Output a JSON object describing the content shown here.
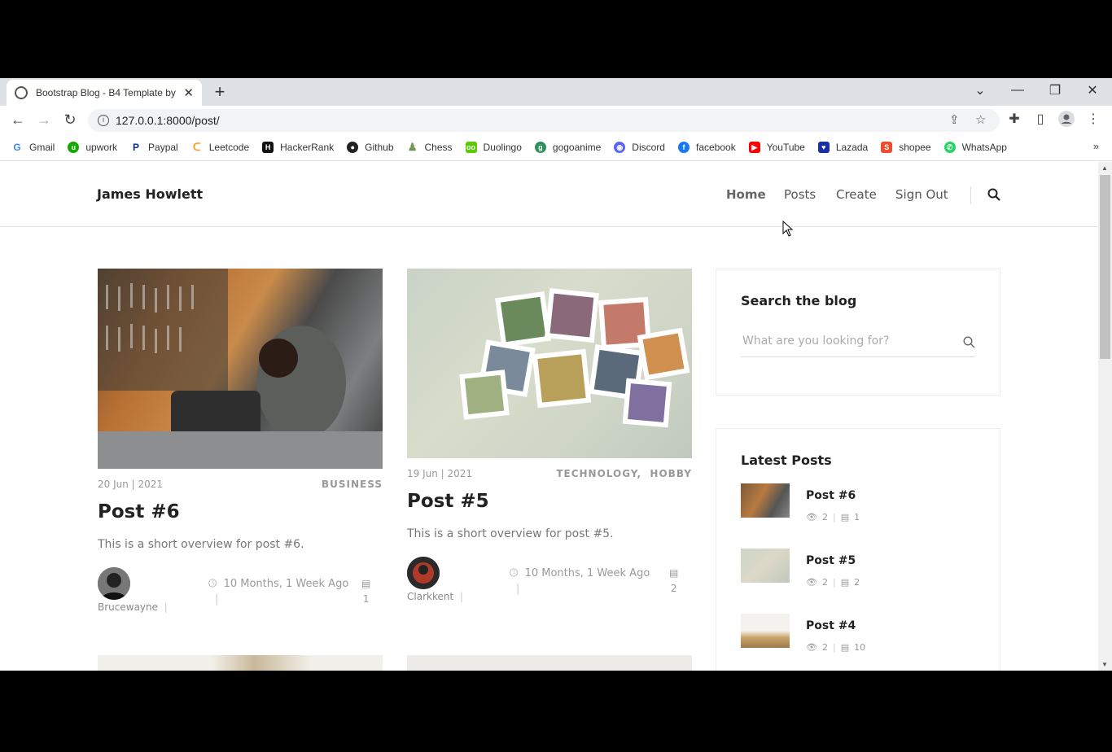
{
  "browser": {
    "tab_title": "Bootstrap Blog - B4 Template by",
    "url": "127.0.0.1:8000/post/",
    "bookmarks": [
      "Gmail",
      "upwork",
      "Paypal",
      "Leetcode",
      "HackerRank",
      "Github",
      "Chess",
      "Duolingo",
      "gogoanime",
      "Discord",
      "facebook",
      "YouTube",
      "Lazada",
      "shopee",
      "WhatsApp"
    ]
  },
  "site": {
    "brand": "James Howlett",
    "nav": {
      "home": "Home",
      "posts": "Posts",
      "create": "Create",
      "signout": "Sign Out"
    }
  },
  "posts": [
    {
      "date": "20 Jun | 2021",
      "category": "BUSINESS",
      "title": "Post #6",
      "desc": "This is a short overview for post #6.",
      "author": "Brucewayne",
      "time": "10 Months, 1 Week Ago",
      "comments": "1"
    },
    {
      "date": "19 Jun | 2021",
      "categories": [
        "TECHNOLOGY",
        "HOBBY"
      ],
      "title": "Post #5",
      "desc": "This is a short overview for post #5.",
      "author": "Clarkkent",
      "time": "10 Months, 1 Week Ago",
      "comments": "2"
    }
  ],
  "sidebar": {
    "search": {
      "title": "Search the blog",
      "placeholder": "What are you looking for?"
    },
    "latest": {
      "title": "Latest Posts",
      "items": [
        {
          "name": "Post #6",
          "views": "2",
          "comments": "1"
        },
        {
          "name": "Post #5",
          "views": "2",
          "comments": "2"
        },
        {
          "name": "Post #4",
          "views": "2",
          "comments": "10"
        }
      ]
    }
  },
  "colors": {
    "accent": "#222222",
    "muted": "#999999"
  }
}
